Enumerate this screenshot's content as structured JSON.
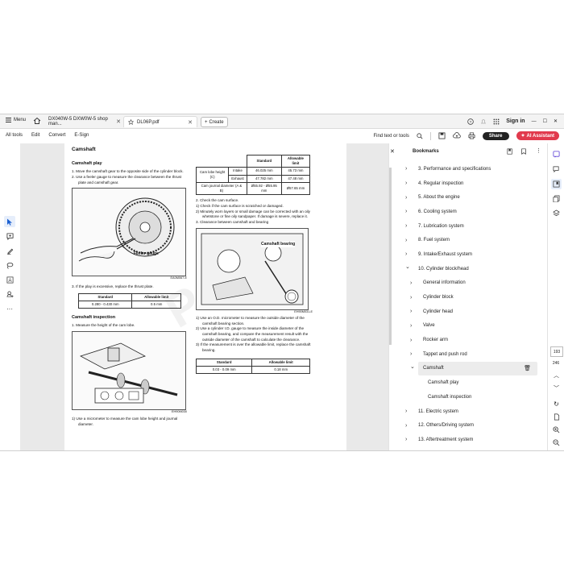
{
  "titlebar": {
    "menu_label": "Menu",
    "tabs": [
      {
        "label": "DX040W-5 DXW0W-5 shop man...",
        "active": false
      },
      {
        "label": "DL06P.pdf",
        "active": true
      }
    ],
    "create_label": "Create",
    "sign_in": "Sign in"
  },
  "toolbar": {
    "menus": [
      "All tools",
      "Edit",
      "Convert",
      "E-Sign"
    ],
    "find_label": "Find text or tools",
    "share_label": "Share",
    "ai_label": "AI Assistant",
    "accent": "#e13a4d"
  },
  "document": {
    "title": "Camshaft",
    "play_heading": "Camshaft play",
    "play_steps": [
      "1.  Move the camshaft gear to the opposite side of the cylinder block.",
      "2.  Use a feeler gauge to measure the clearance between the thrust plate and camshaft gear."
    ],
    "fig1_label": "Feeler gauge",
    "fig1_code": "EA0M067-E",
    "play_step3": "3.  If the play is excessive, replace the thrust plate.",
    "table1": {
      "h1": "Standard",
      "h2": "Allowable limit",
      "v1": "0.280 - 0.430 mm",
      "v2": "0.5 mm"
    },
    "inspection_heading": "Camshaft inspection",
    "insp_step1": "1.  Measure the height of the cam lobe.",
    "fig2_code": "EH90M030",
    "insp_step_bottom": "1)  Use a micrometer to measure the cam lobe height and journal diameter.",
    "spec_table": {
      "h_std": "Standard",
      "h_lim": "Allowable limit",
      "row_label": "Cam lobe height (C)",
      "intake": "Intake",
      "exhaust": "Exhaust",
      "intake_std": "46.025 mm",
      "intake_lim": "45.73 mm",
      "exhaust_std": "47.782 mm",
      "exhaust_lim": "47.48 mm",
      "journal_label": "Cam journal diameter (A & B)",
      "journal_std": "Ø55.92 - Ø55.95 mm",
      "journal_lim": "Ø57.65 mm"
    },
    "right_steps": [
      "2.  Check the cam surface.",
      "1)  Check if the cam surface is scratched or damaged.",
      "2)  Minutely worn layers or small damage can be corrected with an oily whetstone or fine oily sandpaper. If damage is severe, replace it.",
      "3.  Clearance between camshaft and bearing"
    ],
    "fig3_label": "Camshaft bearing",
    "fig3_code": "EH90M031-E",
    "bearing_steps": [
      "1)  Use an O.D. micrometer to measure the outside diameter of the camshaft bearing section.",
      "2)  Use a cylinder I.D. gauge to measure the inside diameter of the camshaft bearing, and compare the measurement result with the outside diameter of the camshaft to calculate the clearance.",
      "3)  If the measurement is over the allowable limit, replace the camshaft bearing."
    ],
    "table2": {
      "h1": "Standard",
      "h2": "Allowable limit",
      "v1": "0.03 - 0.09 mm",
      "v2": "0.18 mm"
    }
  },
  "bookmarks": {
    "title": "Bookmarks",
    "items": [
      {
        "label": "3. Performance and specifications",
        "level": 0,
        "expanded": false
      },
      {
        "label": "4. Regular inspection",
        "level": 0,
        "expanded": false
      },
      {
        "label": "5. About the engine",
        "level": 0,
        "expanded": false
      },
      {
        "label": "6. Cooling system",
        "level": 0,
        "expanded": false
      },
      {
        "label": "7. Lubrication system",
        "level": 0,
        "expanded": false
      },
      {
        "label": "8. Fuel system",
        "level": 0,
        "expanded": false
      },
      {
        "label": "9. Intake/Exhaust system",
        "level": 0,
        "expanded": false
      },
      {
        "label": "10. Cylinder block/head",
        "level": 0,
        "expanded": true
      },
      {
        "label": "General information",
        "level": 1,
        "expanded": false
      },
      {
        "label": "Cylinder block",
        "level": 1,
        "expanded": false
      },
      {
        "label": "Cylinder head",
        "level": 1,
        "expanded": false
      },
      {
        "label": "Valve",
        "level": 1,
        "expanded": false
      },
      {
        "label": "Rocker arm",
        "level": 1,
        "expanded": false
      },
      {
        "label": "Tappet and push rod",
        "level": 1,
        "expanded": false
      },
      {
        "label": "Camshaft",
        "level": 1,
        "expanded": true,
        "selected": true
      },
      {
        "label": "Camshaft play",
        "level": 2
      },
      {
        "label": "Camshaft inspection",
        "level": 2
      },
      {
        "label": "11. Electric system",
        "level": 0,
        "expanded": false
      },
      {
        "label": "12. Others/Driving system",
        "level": 0,
        "expanded": false
      },
      {
        "label": "13. Aftertreatment system",
        "level": 0,
        "expanded": false
      }
    ]
  },
  "pager": {
    "current": "193",
    "total": "246"
  }
}
